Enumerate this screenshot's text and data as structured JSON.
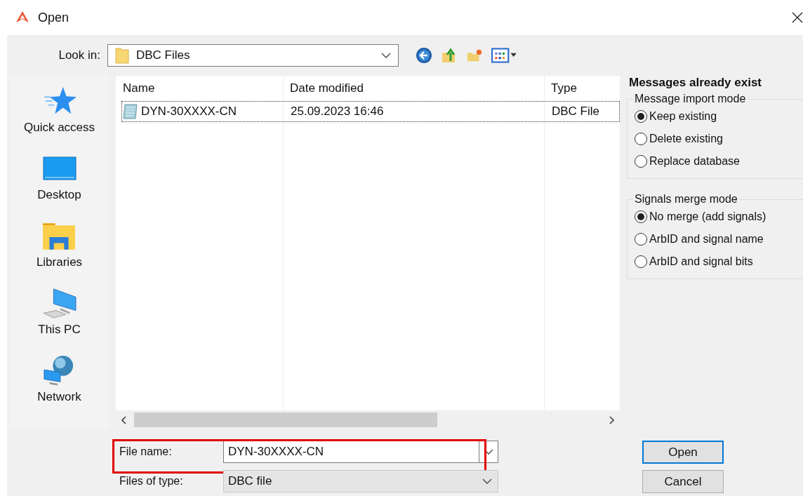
{
  "window": {
    "title": "Open"
  },
  "look_in": {
    "label": "Look in:",
    "value": "DBC Files"
  },
  "places": [
    {
      "label": "Quick access",
      "kind": "star"
    },
    {
      "label": "Desktop",
      "kind": "desktop"
    },
    {
      "label": "Libraries",
      "kind": "libraries"
    },
    {
      "label": "This PC",
      "kind": "pc"
    },
    {
      "label": "Network",
      "kind": "network"
    }
  ],
  "file_list": {
    "columns": [
      "Name",
      "Date modified",
      "Type"
    ],
    "rows": [
      {
        "name": "DYN-30XXXX-CN",
        "date": "25.09.2023 16:46",
        "type": "DBC File",
        "selected": true
      }
    ]
  },
  "options": {
    "title": "Messages already exist",
    "groups": [
      {
        "title": "Message import mode",
        "options": [
          {
            "label": "Keep existing",
            "selected": true
          },
          {
            "label": "Delete existing",
            "selected": false
          },
          {
            "label": "Replace database",
            "selected": false
          }
        ]
      },
      {
        "title": "Signals merge mode",
        "options": [
          {
            "label": "No merge (add signals)",
            "selected": true
          },
          {
            "label": "ArbID and signal name",
            "selected": false
          },
          {
            "label": "ArbID and signal bits",
            "selected": false
          }
        ]
      }
    ]
  },
  "file_name": {
    "label": "File name:",
    "value": "DYN-30XXXX-CN",
    "highlighted": true
  },
  "file_type": {
    "label": "Files of type:",
    "value": "DBC file"
  },
  "buttons": [
    {
      "label": "Open",
      "default": true
    },
    {
      "label": "Cancel",
      "default": false
    }
  ]
}
